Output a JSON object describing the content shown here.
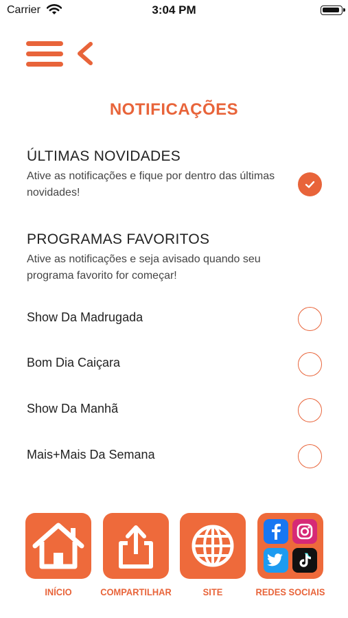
{
  "status_bar": {
    "carrier": "Carrier",
    "time": "3:04 PM"
  },
  "header": {
    "menu_icon": "hamburger-icon",
    "back_icon": "chevron-left-icon"
  },
  "page_title": "NOTIFICAÇÕES",
  "latest_news": {
    "title": "ÚLTIMAS NOVIDADES",
    "description": "Ative as notificações e fique por dentro das últimas novidades!",
    "checked": true
  },
  "favorites": {
    "title": "PROGRAMAS FAVORITOS",
    "description": "Ative as notificações e seja avisado quando seu programa favorito for começar!",
    "programs": [
      {
        "label": "Show Da Madrugada",
        "checked": false
      },
      {
        "label": "Bom Dia Caiçara",
        "checked": false
      },
      {
        "label": "Show Da Manhã",
        "checked": false
      },
      {
        "label": "Mais+Mais Da Semana",
        "checked": false
      }
    ]
  },
  "tabbar": {
    "items": [
      {
        "label": "INÍCIO",
        "icon": "home-icon"
      },
      {
        "label": "COMPARTILHAR",
        "icon": "share-icon"
      },
      {
        "label": "SITE",
        "icon": "globe-icon"
      },
      {
        "label": "REDES SOCIAIS",
        "icon": "social-networks-icon"
      }
    ]
  },
  "colors": {
    "accent": "#e8643a",
    "tab_bg": "#ee6a3b",
    "text": "#222222"
  }
}
